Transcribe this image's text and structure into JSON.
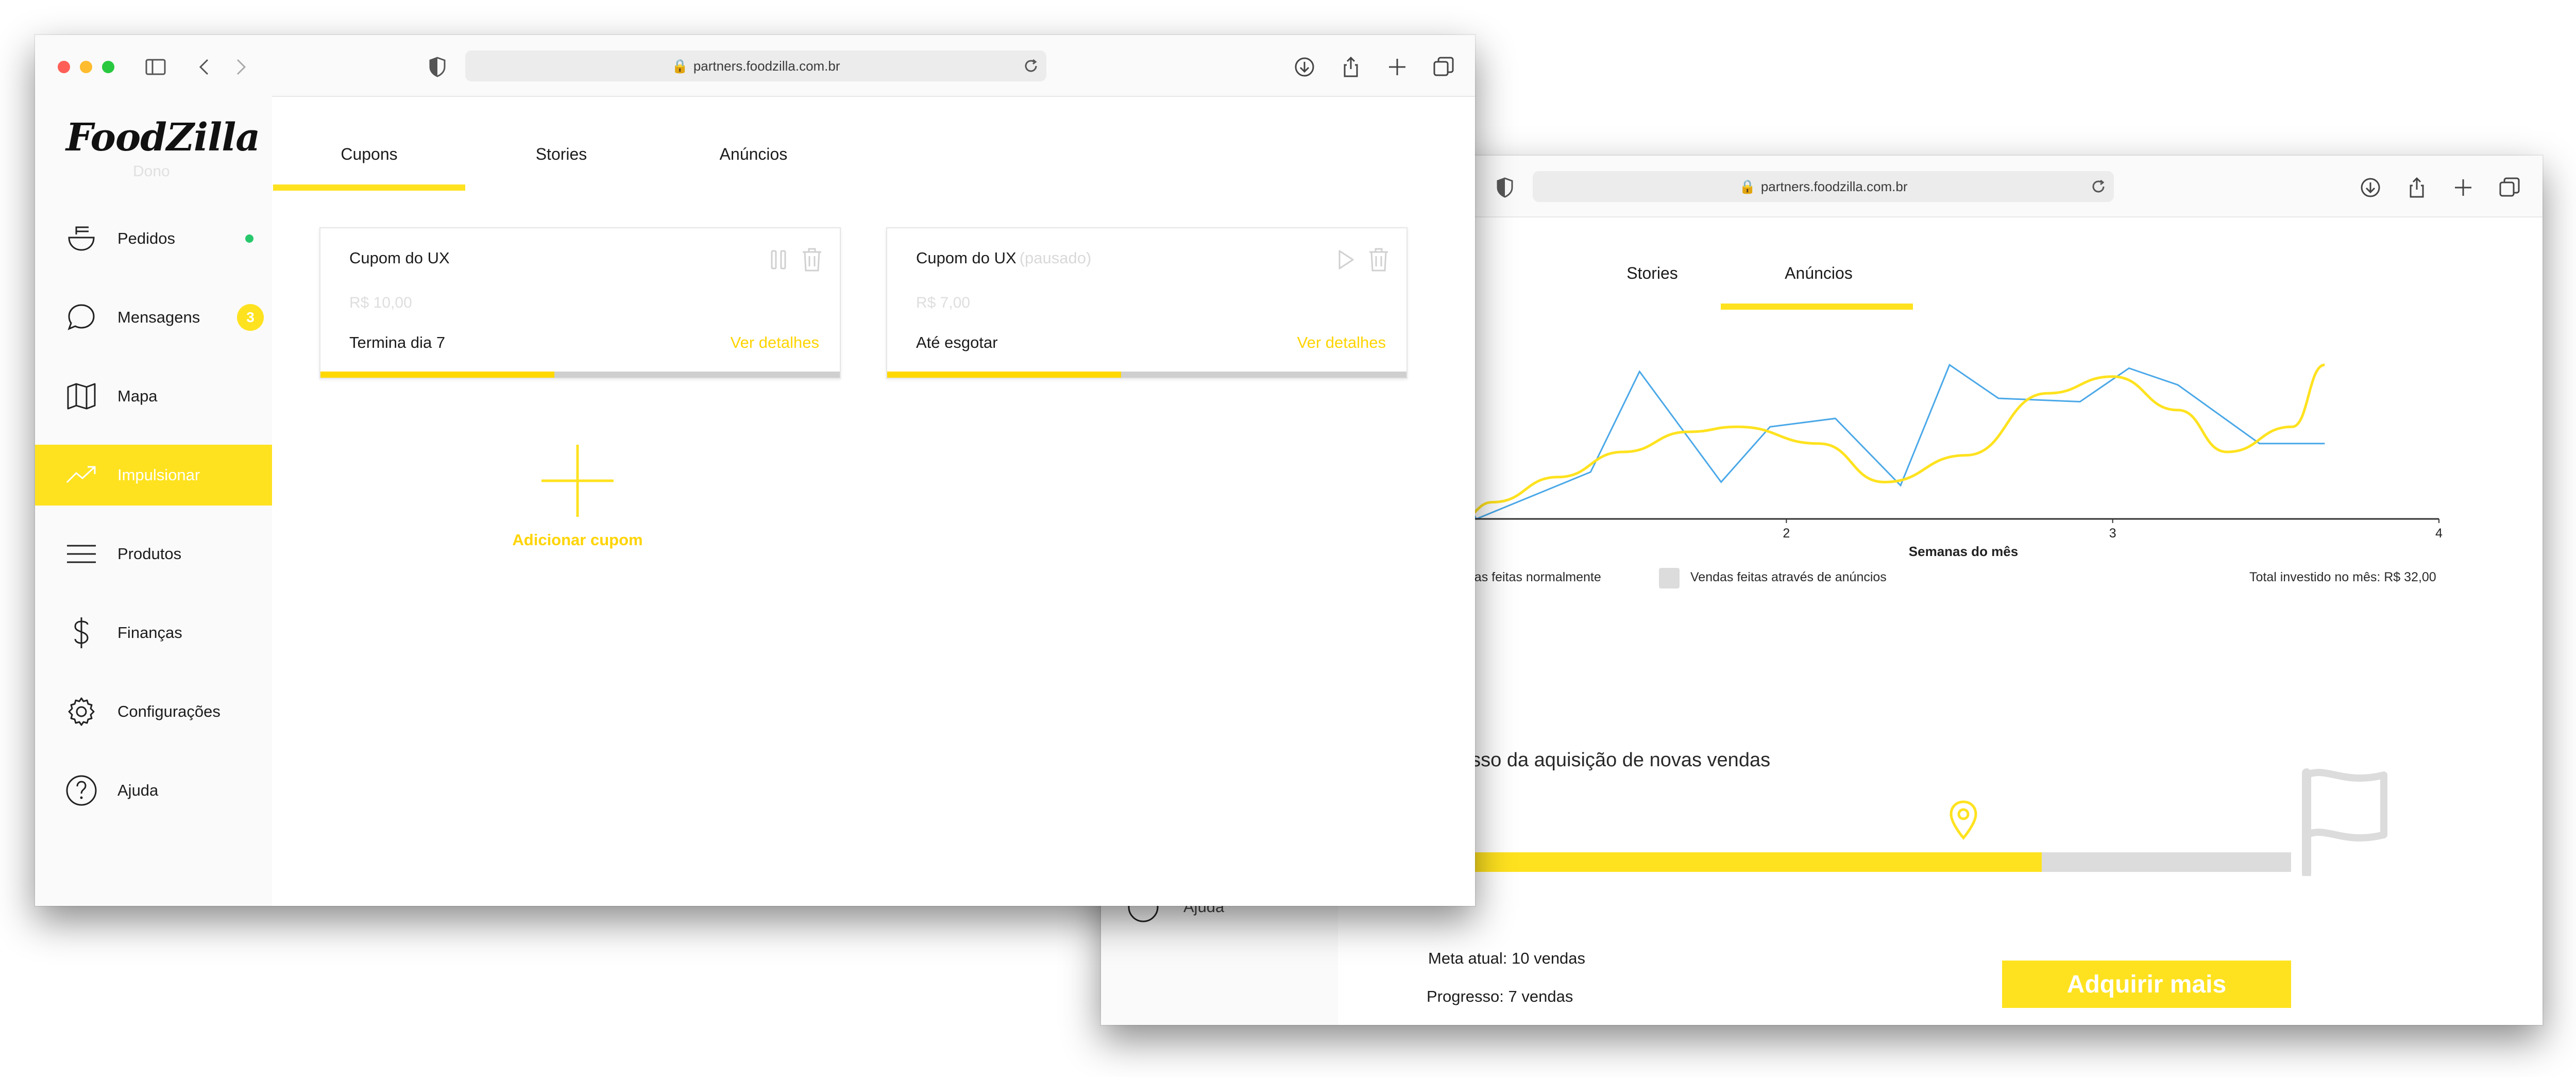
{
  "browser": {
    "url": "partners.foodzilla.com.br",
    "traffic_colors": [
      "#ff5f57",
      "#febc2e",
      "#28c840"
    ]
  },
  "brand": {
    "logo": "FoodZilla",
    "subtitle": "Dono"
  },
  "sidebar": {
    "items": [
      {
        "label": "Pedidos",
        "icon": "bowl-icon",
        "badge_dot": true
      },
      {
        "label": "Mensagens",
        "icon": "chat-icon",
        "badge": "3"
      },
      {
        "label": "Mapa",
        "icon": "map-icon"
      },
      {
        "label": "Impulsionar",
        "icon": "trending-up-icon",
        "active": true
      },
      {
        "label": "Produtos",
        "icon": "menu-lines-icon"
      },
      {
        "label": "Finanças",
        "icon": "dollar-icon"
      },
      {
        "label": "Configurações",
        "icon": "gear-icon"
      },
      {
        "label": "Ajuda",
        "icon": "help-icon"
      }
    ]
  },
  "front": {
    "tabs": [
      {
        "label": "Cupons",
        "active": true
      },
      {
        "label": "Stories"
      },
      {
        "label": "Anúncios"
      }
    ],
    "coupons": [
      {
        "title": "Cupom do UX",
        "status": "",
        "price": "R$ 10,00",
        "ending": "Termina dia 7",
        "link": "Ver detalhes",
        "progress": 0.45
      },
      {
        "title": "Cupom do UX",
        "status": "(pausado)",
        "price": "R$ 7,00",
        "ending": "Até esgotar",
        "link": "Ver detalhes",
        "progress": 0.45
      }
    ],
    "add_label": "Adicionar cupom"
  },
  "back": {
    "tabs": [
      {
        "label": "Stories"
      },
      {
        "label": "Anúncios",
        "active": true
      }
    ],
    "sidebar_partial_label": "Ajuda",
    "legend_normal": "ndas feitas normalmente",
    "legend_ads": "Vendas feitas através de anúncios",
    "total": "Total investido no mês: R$ 32,00",
    "progress_title": "esso da aquisição de novas vendas",
    "progress_fraction": 0.7,
    "goal": "Meta atual: 10 vendas",
    "progress_text": "Progresso: 7 vendas",
    "button": "Adquirir mais"
  },
  "colors": {
    "accent": "#ffe21f",
    "blue_line": "#4aa8e8",
    "yellow_line": "#ffe21f"
  },
  "chart_data": {
    "type": "line",
    "xlabel": "Semanas do mês",
    "x_ticks": [
      "2",
      "3",
      "4"
    ],
    "xlim": [
      1.0,
      4.0
    ],
    "ylim": [
      0,
      100
    ],
    "series": [
      {
        "color": "#4aa8e8",
        "x": [
          1.0,
          1.05,
          1.4,
          1.55,
          1.8,
          1.95,
          2.15,
          2.35,
          2.5,
          2.65,
          2.9,
          3.05,
          3.2,
          3.45,
          3.65
        ],
        "y": [
          15,
          0,
          28,
          88,
          22,
          55,
          60,
          20,
          92,
          72,
          70,
          90,
          80,
          45,
          45
        ]
      },
      {
        "color": "#ffe21f",
        "x": [
          1.0,
          1.1,
          1.3,
          1.5,
          1.7,
          1.85,
          2.1,
          2.3,
          2.55,
          2.8,
          3.0,
          3.2,
          3.35,
          3.55,
          3.65
        ],
        "y": [
          0,
          10,
          25,
          40,
          52,
          55,
          45,
          22,
          38,
          75,
          85,
          65,
          40,
          55,
          92
        ]
      }
    ]
  }
}
